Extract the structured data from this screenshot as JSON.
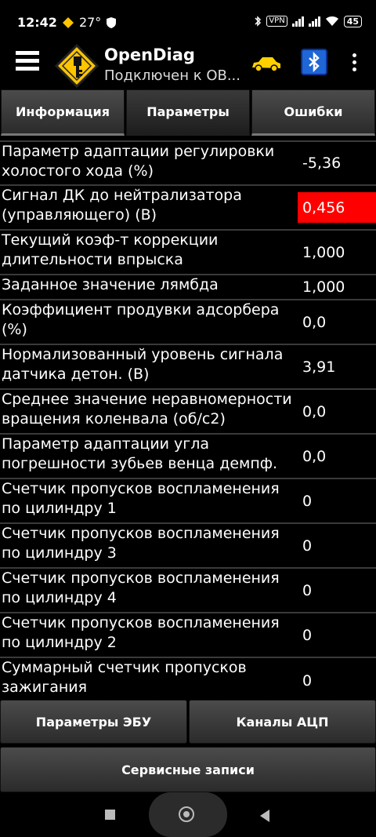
{
  "status": {
    "time": "12:42",
    "temp": "27°",
    "vpn": "VPN",
    "battery": "45"
  },
  "app": {
    "title": "OpenDiag",
    "subtitle": "Подключен к OB..."
  },
  "tabs": [
    {
      "label": "Информация",
      "active": false
    },
    {
      "label": "Параметры",
      "active": true
    },
    {
      "label": "Ошибки",
      "active": false
    }
  ],
  "params": [
    {
      "name": "Параметр адаптации регулировки холостого хода (%)",
      "value": "-5,36",
      "alert": false
    },
    {
      "name": "Сигнал ДК до нейтрализатора (управляющего) (В)",
      "value": "0,456",
      "alert": true
    },
    {
      "name": "Текущий коэф-т коррекции длительности впрыска",
      "value": "1,000",
      "alert": false
    },
    {
      "name": "Заданное значение лямбда",
      "value": "1,000",
      "alert": false
    },
    {
      "name": "Коэффициент продувки адсорбера (%)",
      "value": "0,0",
      "alert": false
    },
    {
      "name": "Нормализованный уровень сигнала датчика детон. (В)",
      "value": "3,91",
      "alert": false
    },
    {
      "name": "Среднее значение неравномерности вращения коленвала (об/с2)",
      "value": "0,0",
      "alert": false
    },
    {
      "name": "Параметр адаптации угла погрешности зубьев венца демпф.",
      "value": "0,0",
      "alert": false
    },
    {
      "name": "Счетчик пропусков воспламенения по цилиндру 1",
      "value": "0",
      "alert": false
    },
    {
      "name": "Счетчик пропусков воспламенения по цилиндру 3",
      "value": "0",
      "alert": false
    },
    {
      "name": "Счетчик пропусков воспламенения по цилиндру 4",
      "value": "0",
      "alert": false
    },
    {
      "name": "Счетчик пропусков воспламенения по цилиндру 2",
      "value": "0",
      "alert": false
    },
    {
      "name": "Суммарный счетчик пропусков зажигания",
      "value": "0",
      "alert": false
    }
  ],
  "bottom": {
    "ecu_params": "Параметры ЭБУ",
    "adc_channels": "Каналы АЦП",
    "service_records": "Сервисные записи"
  },
  "colors": {
    "alert": "#ff0000",
    "bluetooth": "#1f66d6",
    "car": "#ffd000"
  }
}
